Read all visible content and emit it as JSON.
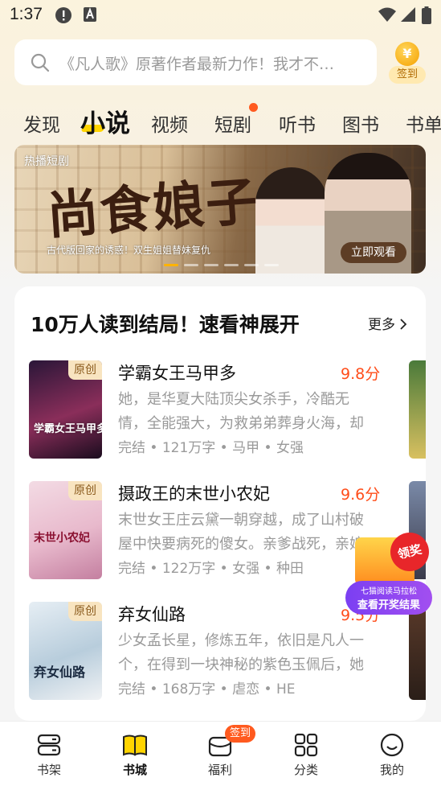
{
  "status_bar": {
    "time": "1:37"
  },
  "search": {
    "placeholder": "《凡人歌》原著作者最新力作！我才不…",
    "sign_label": "签到",
    "coin_symbol": "¥"
  },
  "tabs": [
    {
      "label": "发现"
    },
    {
      "label": "小说",
      "active": true
    },
    {
      "label": "视频"
    },
    {
      "label": "短剧",
      "has_dot": true
    },
    {
      "label": "听书"
    },
    {
      "label": "图书"
    },
    {
      "label": "书单"
    }
  ],
  "banner": {
    "tag": "热播短剧",
    "title": "尚食娘子",
    "subtitle": "古代版回家的诱惑！双生姐姐替妹复仇",
    "cta": "立即观看",
    "page_count": 6,
    "active_page": 1
  },
  "section": {
    "title": "10万人读到结局！速看神展开",
    "more_label": "更多"
  },
  "books": [
    {
      "badge": "原创",
      "cover_text": "学霸女王马甲多",
      "title": "学霸女王马甲多",
      "score": "9.8分",
      "desc": "她，是华夏大陆顶尖女杀手，冷酷无情，全能强大，为救弟弟葬身火海，却",
      "meta": "完结 • 121万字 • 马甲 • 女强"
    },
    {
      "badge": "原创",
      "cover_text": "末世小农妃",
      "title": "摄政王的末世小农妃",
      "score": "9.6分",
      "desc": "末世女王庄云黛一朝穿越，成了山村破屋中快要病死的傻女。亲爹战死，亲娘",
      "meta": "完结 • 122万字 • 女强 • 种田"
    },
    {
      "badge": "原创",
      "cover_text": "弃女仙路",
      "title": "弃女仙路",
      "score": "9.5分",
      "desc": "少女孟长星，修炼五年，依旧是凡人一个，在得到一块神秘的紫色玉佩后，她",
      "meta": "完结 • 168万字 • 虐恋 • HE"
    }
  ],
  "promo": {
    "burst": "领奖",
    "line1": "七猫阅读马拉松",
    "line2": "查看开奖结果"
  },
  "bottom_nav": [
    {
      "label": "书架",
      "icon": "bookshelf-icon"
    },
    {
      "label": "书城",
      "icon": "bookstore-icon",
      "active": true
    },
    {
      "label": "福利",
      "icon": "gift-icon",
      "badge": "签到"
    },
    {
      "label": "分类",
      "icon": "category-icon"
    },
    {
      "label": "我的",
      "icon": "profile-icon"
    }
  ],
  "colors": {
    "accent": "#ffd400",
    "score": "#ff4d1a",
    "badge": "#ff5a1f",
    "promo": "#8a45f0"
  }
}
